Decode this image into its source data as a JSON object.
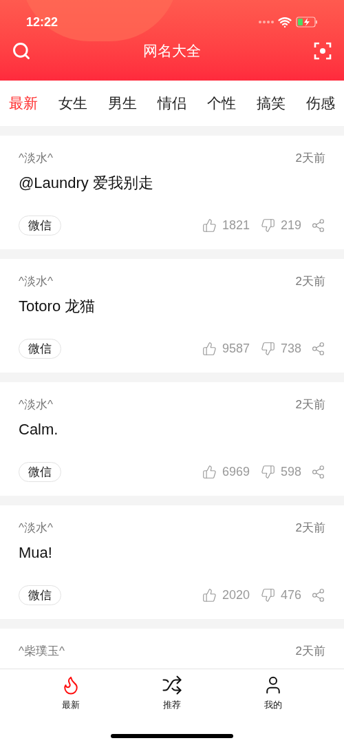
{
  "status_bar": {
    "time": "12:22"
  },
  "header": {
    "title": "网名大全"
  },
  "categories": [
    {
      "label": "最新",
      "selected": true
    },
    {
      "label": "女生",
      "selected": false
    },
    {
      "label": "男生",
      "selected": false
    },
    {
      "label": "情侣",
      "selected": false
    },
    {
      "label": "个性",
      "selected": false
    },
    {
      "label": "搞笑",
      "selected": false
    },
    {
      "label": "伤感",
      "selected": false
    }
  ],
  "posts": [
    {
      "author": "^淡水^",
      "time": "2天前",
      "name": "@Laundry 爱我别走",
      "tag": "微信",
      "likes": "1821",
      "dislikes": "219"
    },
    {
      "author": "^淡水^",
      "time": "2天前",
      "name": "Totoro 龙猫",
      "tag": "微信",
      "likes": "9587",
      "dislikes": "738"
    },
    {
      "author": "^淡水^",
      "time": "2天前",
      "name": "Calm.",
      "tag": "微信",
      "likes": "6969",
      "dislikes": "598"
    },
    {
      "author": "^淡水^",
      "time": "2天前",
      "name": "Mua!",
      "tag": "微信",
      "likes": "2020",
      "dislikes": "476"
    },
    {
      "author": "^柴璞玉^",
      "time": "2天前"
    }
  ],
  "tab_bar": [
    {
      "kind": "latest",
      "label": "最新",
      "selected": true
    },
    {
      "kind": "recommend",
      "label": "推荐",
      "selected": false
    },
    {
      "kind": "me",
      "label": "我的",
      "selected": false
    }
  ]
}
